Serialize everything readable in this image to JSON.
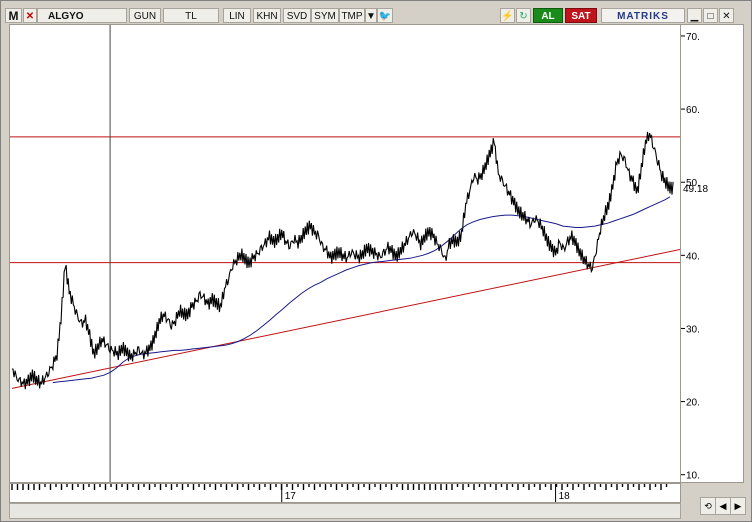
{
  "toolbar": {
    "menu_label": "M",
    "symbol": "ALGYO",
    "period": "GUN",
    "currency": "TL",
    "scale": "LIN",
    "khn": "KHN",
    "svd": "SVD",
    "sym": "SYM",
    "tmp": "TMP",
    "buy": "AL",
    "sell": "SAT",
    "brand": "MATRIKS"
  },
  "icons": {
    "close": "close-icon",
    "dropdown": "chevron-down-icon",
    "twitter": "twitter-icon",
    "bolt": "lightning-icon",
    "refresh": "refresh-icon",
    "minimize": "minimize-icon",
    "maximize": "maximize-icon",
    "window_close": "window-close-icon",
    "sync": "sync-icon",
    "scroll_left": "arrow-left-icon",
    "scroll_right": "arrow-right-icon"
  },
  "colors": {
    "price": "#000000",
    "moving_average": "#1a1a8c",
    "support_resistance": "#c01010",
    "buy": "#1a8a1a",
    "sell": "#c0141c"
  },
  "chart_data": {
    "type": "line",
    "y_ticks": [
      "70.",
      "60.",
      "50.",
      "40.",
      "30.",
      "20.",
      "10."
    ],
    "y_tick_values": [
      70,
      60,
      50,
      40,
      30,
      20,
      10
    ],
    "ylim": [
      9,
      71.5
    ],
    "last_value": "49.18",
    "last_value_num": 49.18,
    "x_labels": [
      "17",
      "18"
    ],
    "x_label_index": [
      66,
      133
    ],
    "horizontal_lines": [
      56.2,
      39.0
    ],
    "trendline": {
      "from": [
        0,
        21.8
      ],
      "to": [
        198,
        40.8
      ]
    },
    "price_series": [
      24.5,
      23.2,
      22.6,
      22.3,
      22.8,
      23.6,
      23.0,
      22.6,
      23.3,
      24.2,
      25.2,
      26.5,
      31.5,
      38.8,
      35.0,
      33.2,
      31.5,
      30.5,
      31.0,
      29.0,
      26.5,
      27.5,
      28.6,
      28.0,
      27.3,
      27.0,
      26.6,
      27.4,
      26.8,
      26.0,
      26.4,
      27.0,
      26.2,
      26.8,
      27.5,
      29.0,
      31.0,
      32.0,
      31.5,
      30.5,
      31.2,
      32.5,
      32.0,
      31.8,
      33.0,
      33.5,
      34.5,
      34.0,
      33.2,
      34.0,
      33.5,
      33.0,
      35.5,
      37.0,
      38.8,
      39.5,
      40.2,
      39.5,
      38.8,
      39.6,
      40.0,
      40.8,
      41.5,
      42.5,
      41.8,
      42.3,
      43.2,
      42.0,
      41.4,
      42.4,
      41.8,
      42.6,
      43.5,
      44.0,
      43.0,
      42.5,
      41.0,
      40.5,
      39.6,
      40.1,
      40.5,
      40.0,
      39.8,
      40.6,
      40.2,
      39.8,
      40.4,
      41.0,
      40.5,
      40.1,
      39.6,
      40.2,
      41.0,
      40.5,
      39.8,
      40.6,
      41.5,
      42.5,
      43.4,
      42.8,
      41.6,
      42.6,
      43.2,
      42.7,
      41.5,
      40.6,
      39.2,
      41.5,
      42.0,
      41.8,
      43.0,
      47.0,
      49.0,
      51.0,
      50.5,
      51.2,
      52.5,
      54.0,
      55.5,
      51.0,
      50.0,
      49.0,
      48.0,
      47.0,
      46.0,
      45.5,
      45.0,
      44.4,
      45.2,
      44.6,
      43.5,
      42.0,
      41.0,
      40.2,
      41.6,
      40.6,
      41.8,
      42.5,
      41.5,
      40.3,
      39.5,
      38.8,
      38.4,
      41.0,
      43.8,
      45.6,
      47.0,
      49.5,
      52.6,
      53.6,
      52.8,
      51.0,
      50.0,
      48.6,
      52.0,
      55.5,
      56.8,
      55.0,
      53.0,
      51.0,
      50.0,
      49.2
    ],
    "ma_series": [
      22.6,
      22.7,
      22.8,
      22.9,
      23.0,
      23.1,
      23.2,
      23.4,
      23.6,
      24.0,
      24.6,
      25.4,
      26.0,
      26.3,
      26.5,
      26.6,
      26.7,
      26.8,
      26.9,
      27.0,
      27.0,
      27.1,
      27.2,
      27.3,
      27.4,
      27.5,
      27.6,
      27.7,
      27.9,
      28.2,
      28.6,
      29.1,
      29.7,
      30.4,
      31.1,
      31.9,
      32.6,
      33.4,
      34.1,
      34.8,
      35.4,
      35.9,
      36.3,
      36.8,
      37.2,
      37.6,
      38.0,
      38.3,
      38.6,
      38.8,
      39.0,
      39.1,
      39.2,
      39.3,
      39.4,
      39.5,
      39.6,
      39.8,
      40.0,
      40.3,
      40.7,
      41.3,
      42.0,
      42.8,
      43.6,
      44.2,
      44.6,
      44.9,
      45.1,
      45.3,
      45.4,
      45.5,
      45.5,
      45.4,
      45.3,
      45.1,
      44.9,
      44.7,
      44.5,
      44.3,
      44.0,
      43.9,
      43.8,
      43.8,
      43.9,
      44.0,
      44.2,
      44.4,
      44.7,
      45.0,
      45.3,
      45.6,
      46.0,
      46.4,
      46.8,
      47.2,
      47.6,
      48.0
    ],
    "ma_start_index": 10,
    "ma_step": 1.56,
    "cursor_index": 24
  },
  "scrollbar": {
    "ticks_hint": "date-density"
  }
}
